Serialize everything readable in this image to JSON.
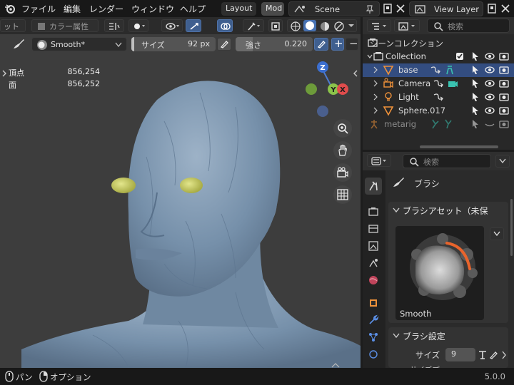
{
  "topbar": {
    "menus": [
      "ファイル",
      "編集",
      "レンダー",
      "ウィンドウ",
      "ヘルプ"
    ],
    "workspaces": [
      "Layout",
      "Mod"
    ],
    "scene": "Scene",
    "view_layer": "View Layer"
  },
  "viewport_header": {
    "mode_label": "ット",
    "color_attr": "カラー属性"
  },
  "tool_header": {
    "brush_name": "Smooth*",
    "size_label": "サイズ",
    "size_value": "92 px",
    "strength_label": "強さ",
    "strength_value": "0.220"
  },
  "stats": [
    {
      "key": "頂点",
      "value": "856,254"
    },
    {
      "key": "面",
      "value": "856,252"
    }
  ],
  "gizmo": {
    "z": "Z",
    "y": "Y",
    "x": "X"
  },
  "outliner": {
    "search_placeholder": "検索",
    "root": "シーンコレクション",
    "collection": "Collection",
    "items": [
      {
        "name": "base",
        "selected": true
      },
      {
        "name": "Camera",
        "selected": false
      },
      {
        "name": "Light",
        "selected": false
      },
      {
        "name": "Sphere.017",
        "selected": false
      }
    ],
    "metarig": "metarig"
  },
  "properties": {
    "search_placeholder": "検索",
    "section_title": "ブラシ",
    "brush_asset_panel": "ブラシアセット（未保",
    "brush_preview_label": "Smooth",
    "brush_settings_panel": "ブラシ設定",
    "size_label": "サイズ",
    "size_value": "9",
    "next_label": "サイズプ"
  },
  "statusbar": {
    "pan": "パン",
    "options": "オプション",
    "version": "5.0.0"
  },
  "colors": {
    "accent_blue": "#4772b3",
    "selected_row": "#334d80",
    "skin": "#7f97b0",
    "eye": "#cfd36a"
  }
}
